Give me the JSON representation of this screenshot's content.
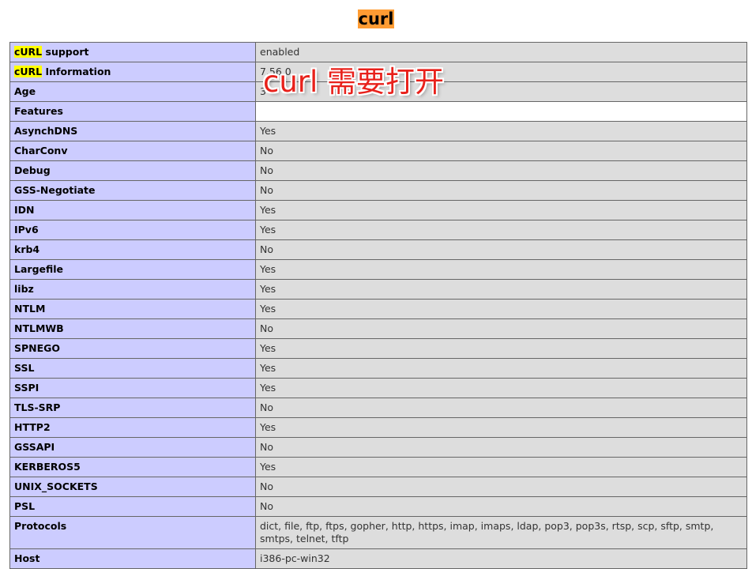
{
  "title": "curl",
  "highlight_colors": {
    "title_bg": "#ff9c33",
    "search_hit": "#ffff00",
    "overlay_text": "#e8211b"
  },
  "rows": [
    {
      "hit": "cURL",
      "label": " support",
      "value": "enabled"
    },
    {
      "hit": "cURL",
      "label": " Information",
      "value": "7.56.0"
    },
    {
      "label": "Age",
      "value": "3"
    },
    {
      "label": "Features",
      "value": "",
      "blank": true
    },
    {
      "label": "AsynchDNS",
      "value": "Yes"
    },
    {
      "label": "CharConv",
      "value": "No"
    },
    {
      "label": "Debug",
      "value": "No"
    },
    {
      "label": "GSS-Negotiate",
      "value": "No"
    },
    {
      "label": "IDN",
      "value": "Yes"
    },
    {
      "label": "IPv6",
      "value": "Yes"
    },
    {
      "label": "krb4",
      "value": "No"
    },
    {
      "label": "Largefile",
      "value": "Yes"
    },
    {
      "label": "libz",
      "value": "Yes"
    },
    {
      "label": "NTLM",
      "value": "Yes"
    },
    {
      "label": "NTLMWB",
      "value": "No"
    },
    {
      "label": "SPNEGO",
      "value": "Yes"
    },
    {
      "label": "SSL",
      "value": "Yes"
    },
    {
      "label": "SSPI",
      "value": "Yes"
    },
    {
      "label": "TLS-SRP",
      "value": "No"
    },
    {
      "label": "HTTP2",
      "value": "Yes"
    },
    {
      "label": "GSSAPI",
      "value": "No"
    },
    {
      "label": "KERBEROS5",
      "value": "Yes"
    },
    {
      "label": "UNIX_SOCKETS",
      "value": "No"
    },
    {
      "label": "PSL",
      "value": "No"
    },
    {
      "label": "Protocols",
      "value": "dict, file, ftp, ftps, gopher, http, https, imap, imaps, ldap, pop3, pop3s, rtsp, scp, sftp, smtp, smtps, telnet, tftp"
    },
    {
      "label": "Host",
      "value": "i386-pc-win32"
    }
  ],
  "overlay": "curl 需要打开"
}
